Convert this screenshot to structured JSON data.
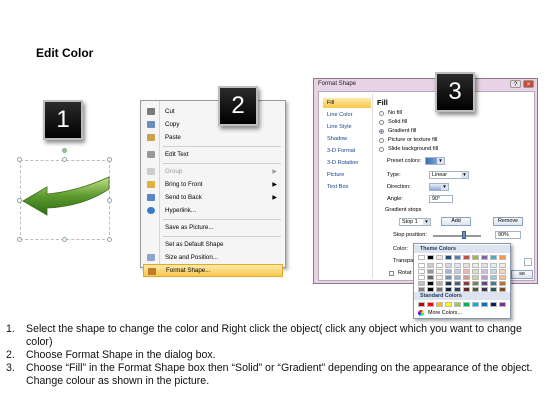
{
  "title": "Edit Color",
  "steps": [
    "1",
    "2",
    "3"
  ],
  "context_menu": {
    "items": [
      {
        "label": "Cut",
        "icon": "scissors-icon",
        "enabled": true
      },
      {
        "label": "Copy",
        "icon": "copy-icon",
        "enabled": true
      },
      {
        "label": "Paste",
        "icon": "paste-icon",
        "enabled": true
      },
      {
        "label": "Edit Text",
        "icon": "edit-text-icon",
        "enabled": true
      },
      {
        "label": "Group",
        "icon": "group-icon",
        "enabled": false
      },
      {
        "label": "Bring to Front",
        "icon": "bring-front-icon",
        "enabled": true
      },
      {
        "label": "Send to Back",
        "icon": "send-back-icon",
        "enabled": true
      },
      {
        "label": "Hyperlink...",
        "icon": "hyperlink-icon",
        "enabled": true
      },
      {
        "label": "Save as Picture...",
        "icon": "",
        "enabled": true
      },
      {
        "label": "Set as Default Shape",
        "icon": "",
        "enabled": true
      },
      {
        "label": "Size and Position...",
        "icon": "size-icon",
        "enabled": true
      },
      {
        "label": "Format Shape...",
        "icon": "format-shape-icon",
        "enabled": true
      }
    ]
  },
  "format_dialog": {
    "title": "Format Shape",
    "categories": [
      "Fill",
      "Line Color",
      "Line Style",
      "Shadow",
      "3-D Format",
      "3-D Rotation",
      "Picture",
      "Text Box"
    ],
    "selected_category": "Fill",
    "pane_title": "Fill",
    "fill_options": [
      "No fill",
      "Solid fill",
      "Gradient fill",
      "Picture or texture fill",
      "Slide background fill"
    ],
    "selected_fill": "Gradient fill",
    "preset_colors_label": "Preset colors:",
    "type_label": "Type:",
    "type_value": "Linear",
    "direction_label": "Direction:",
    "angle_label": "Angle:",
    "angle_value": "90°",
    "gradient_stops_label": "Gradient stops",
    "stop_value": "Stop 1",
    "add_label": "Add",
    "remove_label": "Remove",
    "stop_position_label": "Stop position:",
    "stop_position_value": "90%",
    "color_label": "Color:",
    "transparency_label": "Transpa",
    "rotate_label": "Rotat",
    "close_label": "se"
  },
  "palette": {
    "theme_header": "Theme Colors",
    "standard_header": "Standard Colors",
    "more_label": "More Colors...",
    "theme_top": [
      "#ffffff",
      "#000000",
      "#eeece1",
      "#1f497d",
      "#4f81bd",
      "#c0504d",
      "#9bbb59",
      "#8064a2",
      "#4bacc6",
      "#f79646"
    ],
    "standard": [
      "#c00000",
      "#ff0000",
      "#ffc000",
      "#ffff00",
      "#92d050",
      "#00b050",
      "#00b0f0",
      "#0070c0",
      "#002060",
      "#7030a0"
    ]
  },
  "instructions": [
    {
      "num": "1.",
      "text": "Select the shape to change the color and Right click the object( click any object which you want to change color)"
    },
    {
      "num": "2.",
      "text": "Choose Format Shape in the dialog box."
    },
    {
      "num": "3.",
      "text": "Choose “Fill” in the Format Shape box then “Solid” or “Gradient” depending on the appearance of the object. Change colour as shown in the picture."
    }
  ]
}
